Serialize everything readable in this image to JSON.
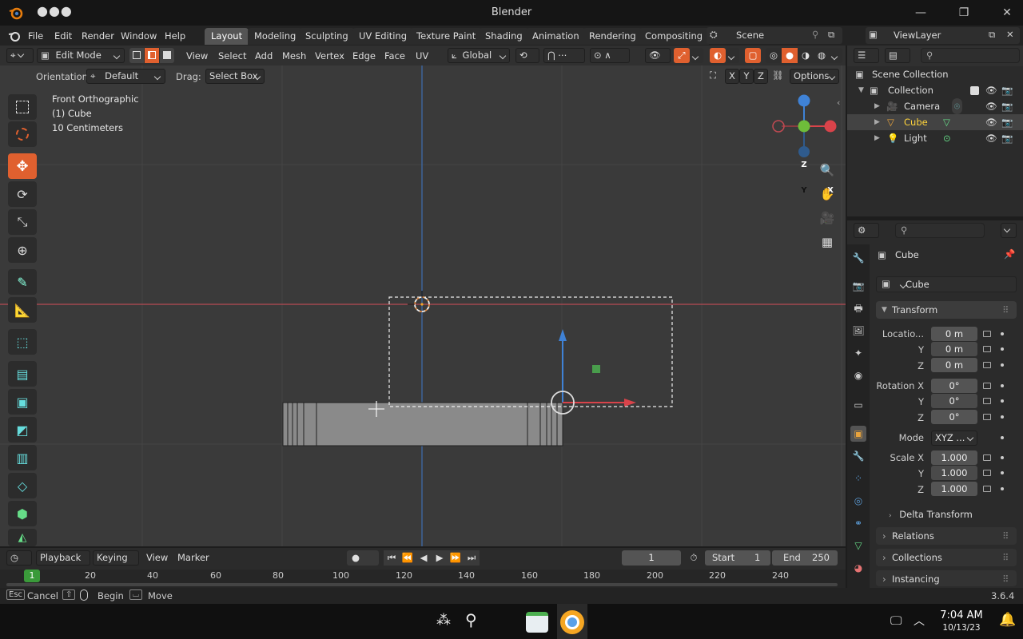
{
  "window": {
    "title": "Blender"
  },
  "menubar": {
    "menus": [
      "File",
      "Edit",
      "Render",
      "Window",
      "Help"
    ],
    "workspaces": [
      "Layout",
      "Modeling",
      "Sculpting",
      "UV Editing",
      "Texture Paint",
      "Shading",
      "Animation",
      "Rendering",
      "Compositing"
    ],
    "active_workspace": "Layout",
    "scene": "Scene",
    "view_layer": "ViewLayer"
  },
  "header3d": {
    "mode": "Edit Mode",
    "menus": [
      "View",
      "Select",
      "Add",
      "Mesh",
      "Vertex",
      "Edge",
      "Face",
      "UV"
    ],
    "transform_orientation": "Global"
  },
  "toolsettings": {
    "orientation_label": "Orientation:",
    "orientation_value": "Default",
    "drag_label": "Drag:",
    "drag_value": "Select Box",
    "axes": [
      "X",
      "Y",
      "Z"
    ],
    "options": "Options"
  },
  "viewport": {
    "view_name": "Front Orthographic",
    "object_label": "(1) Cube",
    "scale_label": "10 Centimeters",
    "gizmo_axes": {
      "z": "Z",
      "y": "Y",
      "x": "X"
    }
  },
  "outliner": {
    "root": "Scene Collection",
    "collection": "Collection",
    "items": [
      {
        "name": "Camera",
        "selected": false
      },
      {
        "name": "Cube",
        "selected": true
      },
      {
        "name": "Light",
        "selected": false
      }
    ]
  },
  "properties": {
    "object_name": "Cube",
    "data_name": "Cube",
    "panel_transform": "Transform",
    "location_label": "Locatio...",
    "location": [
      "0 m",
      "0 m",
      "0 m"
    ],
    "rotation_label": "Rotation X",
    "rotation": [
      "0°",
      "0°",
      "0°"
    ],
    "mode_label": "Mode",
    "mode_value": "XYZ ...",
    "scale_label": "Scale X",
    "scale": [
      "1.000",
      "1.000",
      "1.000"
    ],
    "axis_y": "Y",
    "axis_z": "Z",
    "delta_transform": "Delta Transform",
    "relations": "Relations",
    "collections": "Collections",
    "instancing": "Instancing"
  },
  "timeline": {
    "menus": [
      "Playback",
      "Keying",
      "View",
      "Marker"
    ],
    "current_frame": "1",
    "start_label": "Start",
    "start_value": "1",
    "end_label": "End",
    "end_value": "250",
    "ruler_current": "1",
    "ruler_ticks": [
      "20",
      "40",
      "60",
      "80",
      "100",
      "120",
      "140",
      "160",
      "180",
      "200",
      "220",
      "240"
    ]
  },
  "statusbar": {
    "esc_key": "Esc",
    "cancel": "Cancel",
    "begin": "Begin",
    "move": "Move",
    "version": "3.6.4"
  },
  "taskbar": {
    "time": "7:04 AM",
    "date": "10/13/23"
  },
  "colors": {
    "accent_orange": "#e0602f",
    "axis_x": "#d9434a",
    "axis_y": "#6ebd3a",
    "axis_z": "#3f82d6",
    "selected_text": "#ffd43b"
  }
}
